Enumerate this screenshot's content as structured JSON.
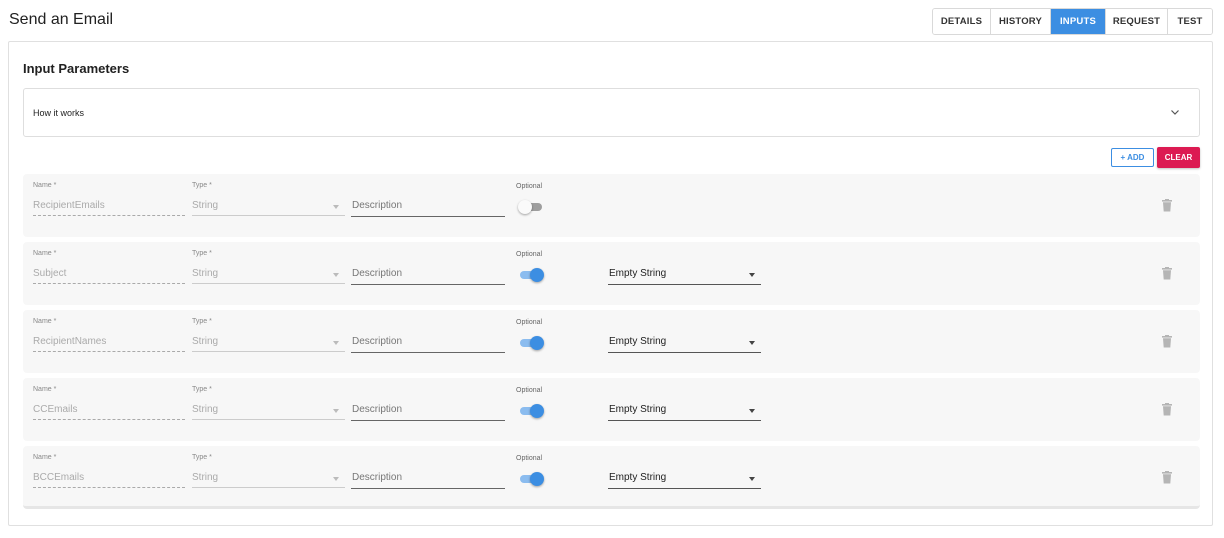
{
  "page": {
    "title": "Send an Email"
  },
  "tabs": [
    {
      "label": "DETAILS",
      "active": false
    },
    {
      "label": "HISTORY",
      "active": false
    },
    {
      "label": "INPUTS",
      "active": true
    },
    {
      "label": "REQUEST",
      "active": false
    },
    {
      "label": "TEST",
      "active": false
    }
  ],
  "section": {
    "title": "Input Parameters",
    "how_it_works": "How it works",
    "add_label": "+ ADD",
    "clear_label": "CLEAR"
  },
  "field_labels": {
    "name": "Name *",
    "type": "Type *",
    "optional": "Optional",
    "description": "Description"
  },
  "parameters": [
    {
      "name": "RecipientEmails",
      "type": "String",
      "optional": false,
      "default": ""
    },
    {
      "name": "Subject",
      "type": "String",
      "optional": true,
      "default": "Empty String"
    },
    {
      "name": "RecipientNames",
      "type": "String",
      "optional": true,
      "default": "Empty String"
    },
    {
      "name": "CCEmails",
      "type": "String",
      "optional": true,
      "default": "Empty String"
    },
    {
      "name": "BCCEmails",
      "type": "String",
      "optional": true,
      "default": "Empty String"
    }
  ],
  "colors": {
    "accent": "#3c8ee2",
    "danger": "#dc1a52"
  },
  "icons": {
    "expand": "chevron-down-icon",
    "delete": "trash-icon",
    "dropdown": "caret-down-icon"
  }
}
